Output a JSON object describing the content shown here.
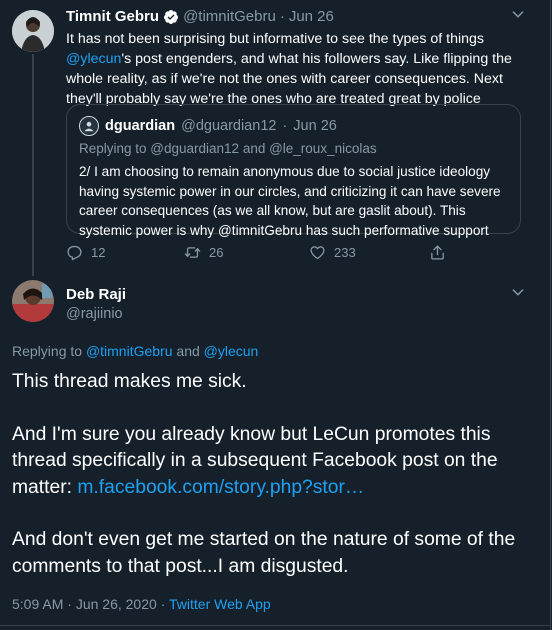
{
  "tweet1": {
    "name": "Timnit Gebru",
    "handle": "@timnitGebru",
    "sep": "·",
    "date": "Jun 26",
    "body_mention": "@ylecun",
    "body_pre": "It has not been surprising but informative to see the types of things ",
    "body_post": "'s post engenders, and what his followers say. Like flipping the whole reality, as if we're not the ones with career consequences. Next they'll probably say we're the ones who are treated great by police",
    "quote": {
      "name": "dguardian",
      "handle": "@dguardian12",
      "sep": "·",
      "date": "Jun 26",
      "replying": "Replying to @dguardian12 and @le_roux_nicolas",
      "body": "2/ I am choosing to remain anonymous due to social justice ideology having systemic power in our circles, and criticizing it can have severe career consequences (as we all know, but are gaslit about). This systemic power is why @timnitGebru has such performative support"
    },
    "actions": {
      "replies": "12",
      "retweets": "26",
      "likes": "233"
    }
  },
  "tweet2": {
    "name": "Deb Raji",
    "handle": "@rajiinio",
    "replying_label": "Replying to",
    "replying_user1": "@timnitGebru",
    "replying_and": "and",
    "replying_user2": "@ylecun",
    "p1": "This thread makes me sick.",
    "p2_pre": "And I'm sure you already know but LeCun promotes this thread specifically in a subsequent Facebook post on the matter: ",
    "p2_link": "m.facebook.com/story.php?stor…",
    "p3": "And don't even get me started on the nature of some of the comments to that post...I am disgusted.",
    "time": "5:09 AM",
    "sep1": "·",
    "date": "Jun 26, 2020",
    "sep2": "·",
    "source": "Twitter Web App"
  },
  "icons": {
    "verified": "verified-badge-icon",
    "chevron": "chevron-down-icon",
    "reply": "reply-icon",
    "retweet": "retweet-icon",
    "like": "heart-icon",
    "share": "share-icon"
  },
  "colors": {
    "background": "#15202b",
    "accent": "#1da1f2",
    "muted": "#8899a6",
    "border": "#38444d"
  }
}
